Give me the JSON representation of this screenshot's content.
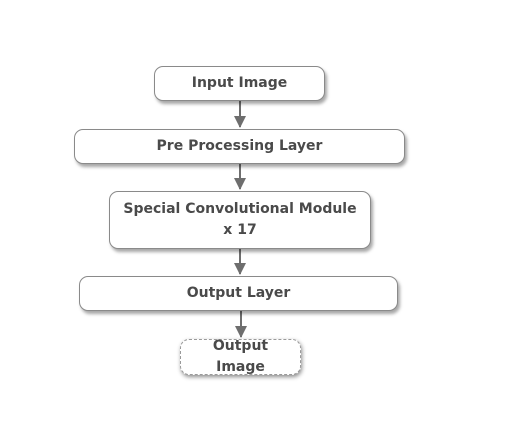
{
  "diagram": {
    "nodes": [
      {
        "id": "input-image",
        "label": "Input Image"
      },
      {
        "id": "pre-processing-layer",
        "label": "Pre Processing Layer"
      },
      {
        "id": "special-convolutional-module",
        "label": "Special Convolutional Module x 17"
      },
      {
        "id": "output-layer",
        "label": "Output Layer"
      },
      {
        "id": "output-image",
        "label": "Output Image"
      }
    ],
    "edges": [
      {
        "from": "input-image",
        "to": "pre-processing-layer"
      },
      {
        "from": "pre-processing-layer",
        "to": "special-convolutional-module"
      },
      {
        "from": "special-convolutional-module",
        "to": "output-layer"
      },
      {
        "from": "output-layer",
        "to": "output-image"
      }
    ],
    "colors": {
      "box_border": "#8a8a8a",
      "text": "#4a4a4a",
      "arrow": "#6e6e6e"
    }
  }
}
